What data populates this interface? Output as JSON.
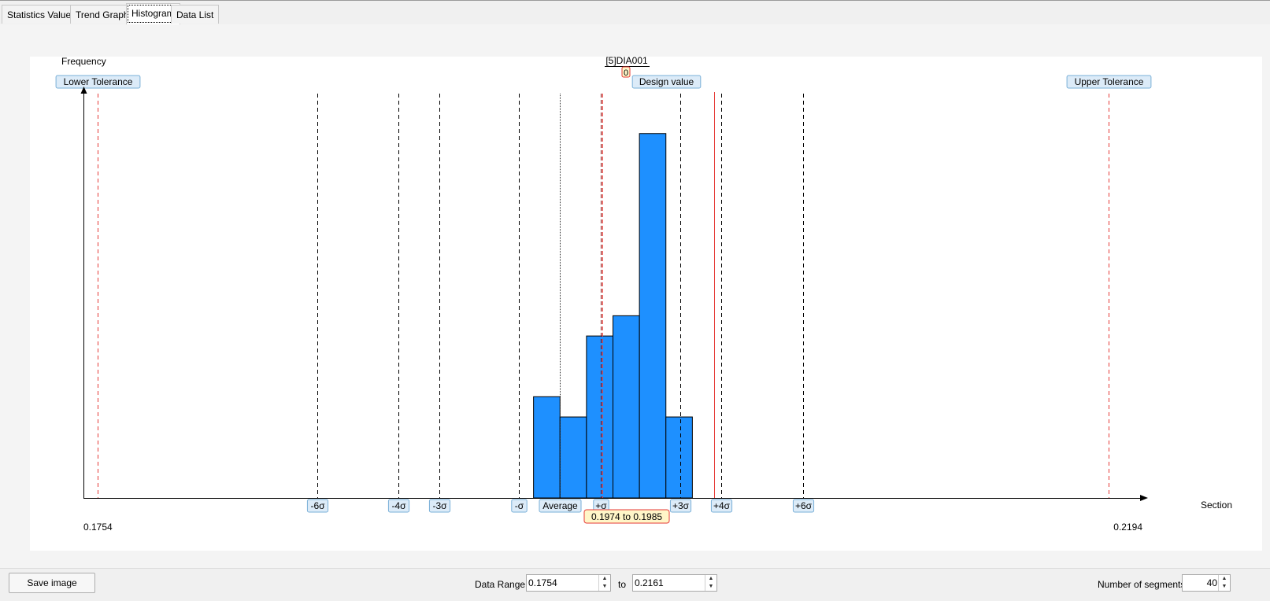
{
  "tabs": [
    {
      "label": "Statistics Values"
    },
    {
      "label": "Trend Graph"
    },
    {
      "label": "Histogram"
    },
    {
      "label": "Data List"
    }
  ],
  "active_tab": "Histogram",
  "colors": {
    "bar_fill": "#1e90ff",
    "tolerance_line": "#e53935",
    "design_line": "#e53935",
    "sigma_line": "#000000",
    "label_bg": "#dcebf8",
    "label_border": "#7ab0d8",
    "tooltip_bg": "#fff6c8",
    "tooltip_border": "#e53935"
  },
  "chart_data": {
    "type": "bar",
    "title": "[5]DIA001",
    "title_sub": "0",
    "ylabel": "Frequency",
    "xlabel": "Section",
    "x_min_label": "0.1754",
    "x_max_label": "0.2194",
    "xlim": [
      0.1754,
      0.2194
    ],
    "bins": [
      {
        "from": 0.1941,
        "to": 0.1952,
        "value": 5
      },
      {
        "from": 0.1952,
        "to": 0.1963,
        "value": 4
      },
      {
        "from": 0.1963,
        "to": 0.1974,
        "value": 8
      },
      {
        "from": 0.1974,
        "to": 0.1985,
        "value": 9
      },
      {
        "from": 0.1985,
        "to": 0.1996,
        "value": 18
      },
      {
        "from": 0.1996,
        "to": 0.2007,
        "value": 4
      }
    ],
    "ymax": 19,
    "reference_lines": [
      {
        "label": "Lower Tolerance",
        "x": 0.176,
        "style": "tolerance",
        "label_pos": "top"
      },
      {
        "label": "Upper Tolerance",
        "x": 0.218,
        "style": "tolerance",
        "label_pos": "top"
      },
      {
        "label": "Design value",
        "x": 0.2016,
        "style": "design",
        "label_pos": "top"
      },
      {
        "label": "-6σ",
        "x": 0.1851,
        "style": "sigma",
        "label_pos": "bottom"
      },
      {
        "label": "-4σ",
        "x": 0.1885,
        "style": "sigma",
        "label_pos": "bottom"
      },
      {
        "label": "-3σ",
        "x": 0.1902,
        "style": "sigma",
        "label_pos": "bottom"
      },
      {
        "label": "-σ",
        "x": 0.1935,
        "style": "sigma",
        "label_pos": "bottom"
      },
      {
        "label": "Average",
        "x": 0.1952,
        "style": "average",
        "label_pos": "bottom"
      },
      {
        "label": "+σ",
        "x": 0.1969,
        "style": "sigma_red",
        "label_pos": "bottom"
      },
      {
        "label": "+3σ",
        "x": 0.2002,
        "style": "sigma",
        "label_pos": "bottom"
      },
      {
        "label": "+4σ",
        "x": 0.2019,
        "style": "sigma",
        "label_pos": "bottom"
      },
      {
        "label": "+6σ",
        "x": 0.2053,
        "style": "sigma",
        "label_pos": "bottom"
      }
    ],
    "tooltip": "0.1974 to 0.1985"
  },
  "bottom": {
    "save_label": "Save image",
    "data_range_label": "Data Range",
    "range_from": "0.1754",
    "to_label": "to",
    "range_to": "0.2161",
    "segments_label": "Number of segments",
    "segments": "40"
  }
}
